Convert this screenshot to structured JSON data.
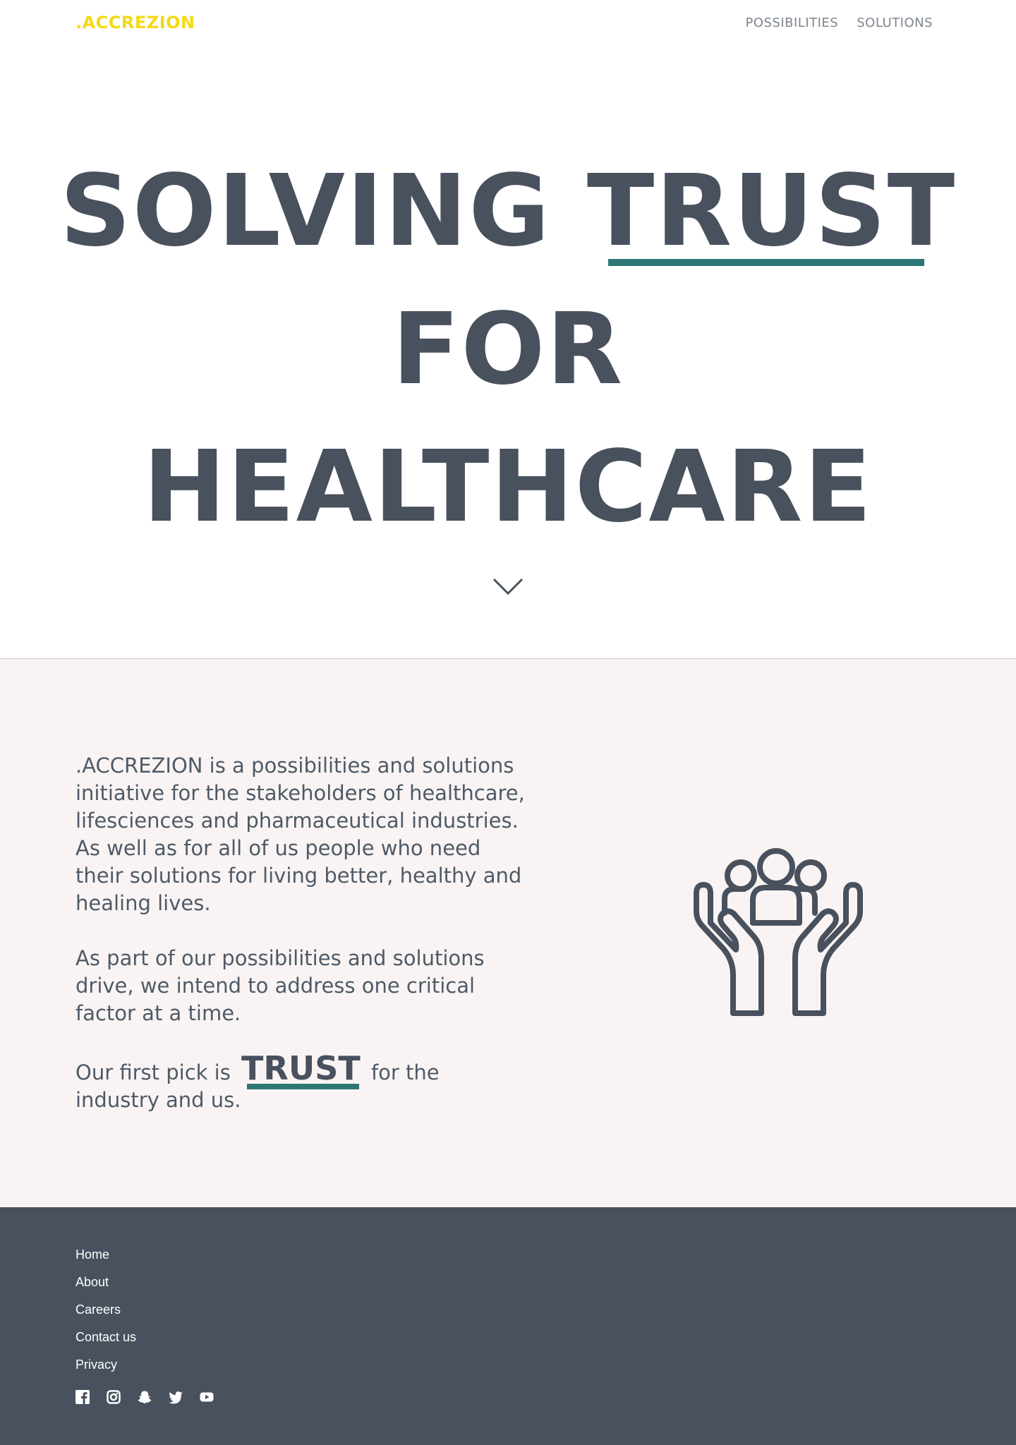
{
  "header": {
    "logo": ".ACCREZION",
    "nav": [
      "POSSIBILITIES",
      "SOLUTIONS"
    ]
  },
  "hero": {
    "line1_a": "SOLVING",
    "line1_b": "TRUST",
    "line2": "FOR",
    "line3": "HEALTHCARE"
  },
  "about": {
    "p1": ".ACCREZION is a possibilities and solutions initiative for the stakeholders of healthcare, lifesciences and pharmaceutical industries. As well as for all of us people who need their solutions for living better, healthy and healing lives.",
    "p2": "As part of our possibilities and solutions drive, we intend to address one critical factor at a time.",
    "p3_before": "Our first pick is",
    "p3_highlight": "TRUST",
    "p3_after": "for the industry and us."
  },
  "footer": {
    "links": [
      "Home",
      "About",
      "Careers",
      "Contact us",
      "Privacy"
    ],
    "socials": [
      "facebook-icon",
      "instagram-icon",
      "snapchat-icon",
      "twitter-icon",
      "youtube-icon"
    ]
  },
  "colors": {
    "brand_yellow": "#f5d916",
    "accent_teal": "#2e7776",
    "slate": "#48515d",
    "section_bg": "#f9f4f3"
  }
}
